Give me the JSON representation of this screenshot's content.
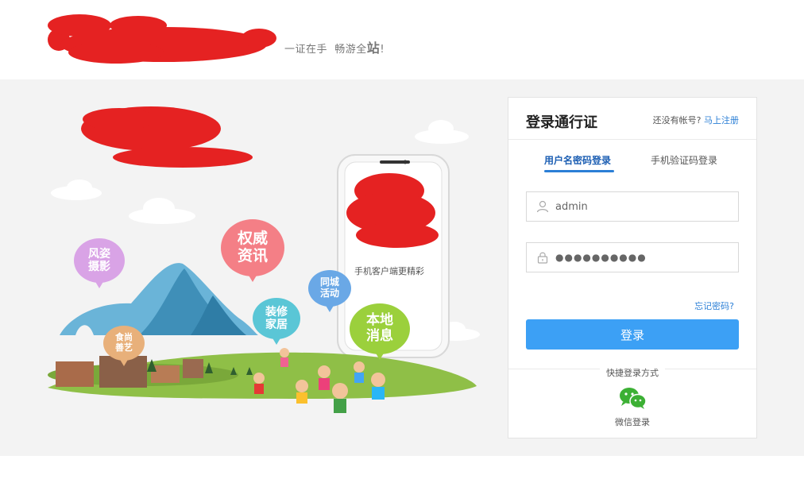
{
  "header": {
    "slogan_part1": "一证在手",
    "slogan_part2": "畅游全",
    "slogan_big": "站",
    "slogan_end": "!"
  },
  "illustration": {
    "bubbles": [
      "风姿\n摄影",
      "权威\n资讯",
      "同城\n活动",
      "装修\n家居",
      "本地\n消息",
      "食尚\n善艺"
    ],
    "phone_caption": "手机客户端更精彩"
  },
  "login": {
    "title": "登录通行证",
    "register_hint": "还没有帐号?",
    "register_link": "马上注册",
    "tabs": [
      {
        "label": "用户名密码登录",
        "active": true
      },
      {
        "label": "手机验证码登录",
        "active": false
      }
    ],
    "username_value": "admin",
    "password_value": "●●●●●●●●●●",
    "forgot_link": "忘记密码?",
    "submit_label": "登录",
    "quick_login_label": "快捷登录方式",
    "wechat_label": "微信登录"
  },
  "colors": {
    "primary": "#3ca0f5",
    "link": "#2b7fd6",
    "redaction": "#e52222",
    "stage_bg": "#f3f3f3"
  }
}
